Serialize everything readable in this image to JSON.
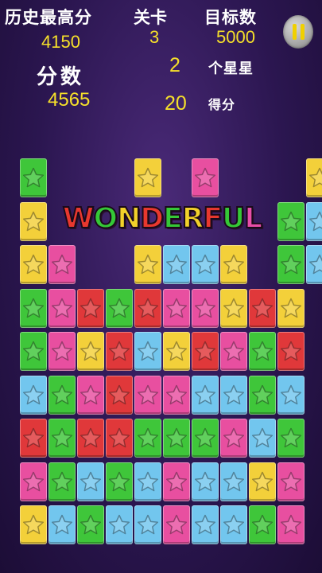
{
  "hud": {
    "best_label": "历史最高分",
    "best_value": "4150",
    "level_label": "关卡",
    "level_value": "3",
    "target_label": "目标数",
    "target_value": "5000",
    "score_label": "分数",
    "score_value": "4565",
    "stars_count": "2",
    "stars_label": "个星星",
    "points_value": "20",
    "points_label": "得分"
  },
  "banner": {
    "text": "WONDERFUL",
    "letter_colors": [
      "#e8382e",
      "#35c837",
      "#f2d12a",
      "#e8382e",
      "#35c837",
      "#f2d12a",
      "#e8382e",
      "#35c837",
      "#e84ea8"
    ]
  },
  "colors": {
    "G": "#3fc63a",
    "Y": "#f3d03a",
    "P": "#e84fa0",
    "B": "#72c6ee",
    "R": "#e0383a"
  },
  "board": {
    "columns": 11,
    "rows": [
      "G...Y.P...Y",
      "Y........GB",
      "YP..YBBY.GB",
      "GPRGRPPYRY",
      "GPYRBYRPGR",
      "BGPRPPBBGB",
      "RGRRGGGPBG",
      "PGBGBPBBYP",
      "YBGBBPBBGP"
    ]
  }
}
